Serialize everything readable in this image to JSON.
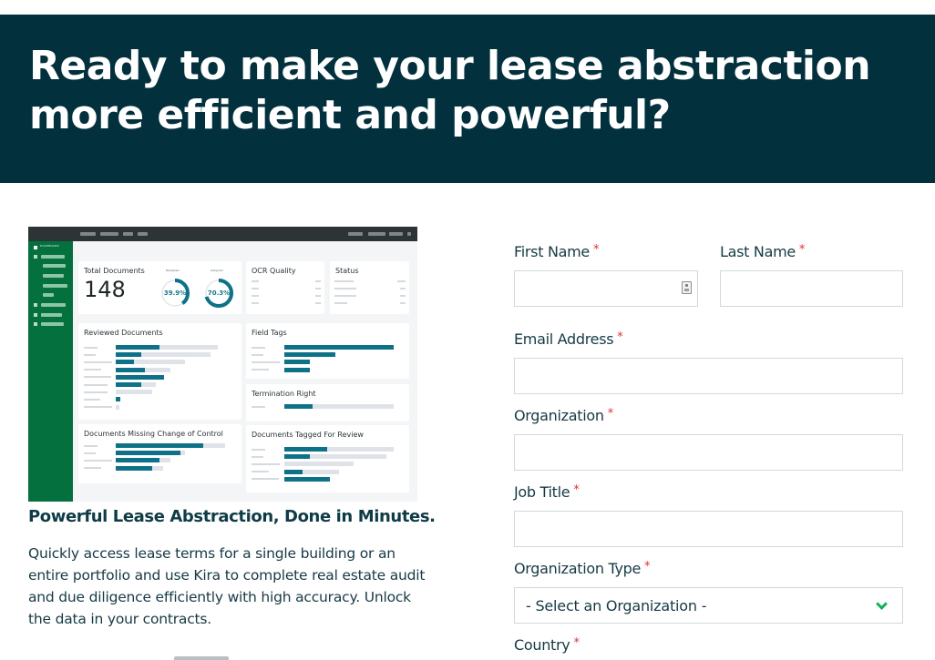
{
  "hero": {
    "title": "Ready to make your lease abstraction more efficient and powerful?",
    "background_color": "#02303d"
  },
  "dashboard_preview": {
    "sidebar_label": "DASHBOARD",
    "sidebar_color": "#04703e",
    "accent_color": "#0d7188",
    "total_documents": {
      "label": "Total Documents",
      "value": "148",
      "reviewed": {
        "label": "Reviewed",
        "value": "39.9%",
        "fraction": 0.399
      },
      "assigned": {
        "label": "Assigned",
        "value": "70.3%",
        "fraction": 0.703
      }
    },
    "ocr_quality": {
      "title": "OCR Quality"
    },
    "status": {
      "title": "Status"
    },
    "reviewed_documents": {
      "title": "Reviewed Documents",
      "bars": [
        {
          "total": 0.93,
          "filled": 0.4
        },
        {
          "total": 0.87,
          "filled": 0.23
        },
        {
          "total": 0.63,
          "filled": 0.17
        },
        {
          "total": 0.5,
          "filled": 0.27
        },
        {
          "total": 0.44,
          "filled": 0.44
        },
        {
          "total": 0.37,
          "filled": 0.23
        },
        {
          "total": 0.33,
          "filled": 0.0
        },
        {
          "total": 0.04,
          "filled": 0.04
        },
        {
          "total": 0.03,
          "filled": 0.0
        }
      ]
    },
    "field_tags": {
      "title": "Field Tags",
      "bars": [
        {
          "total": 1.0,
          "filled": 1.0
        },
        {
          "total": 0.47,
          "filled": 0.47
        },
        {
          "total": 0.23,
          "filled": 0.23
        },
        {
          "total": 0.23,
          "filled": 0.23
        }
      ]
    },
    "termination_right": {
      "title": "Termination Right",
      "bars": [
        {
          "total": 1.0,
          "filled": 0.26
        }
      ]
    },
    "missing_change_of_control": {
      "title": "Documents Missing Change of Control",
      "bars": [
        {
          "total": 1.0,
          "filled": 0.8
        },
        {
          "total": 0.63,
          "filled": 0.59
        },
        {
          "total": 0.5,
          "filled": 0.4
        },
        {
          "total": 0.43,
          "filled": 0.33
        }
      ]
    },
    "tagged_for_review": {
      "title": "Documents Tagged For Review",
      "bars": [
        {
          "total": 1.0,
          "filled": 0.39
        },
        {
          "total": 0.93,
          "filled": 0.23
        },
        {
          "total": 0.63,
          "filled": 0.0
        },
        {
          "total": 0.5,
          "filled": 0.17
        },
        {
          "total": 0.42,
          "filled": 0.42
        }
      ]
    }
  },
  "feature": {
    "heading": "Powerful Lease Abstraction, Done in Minutes.",
    "description": "Quickly access lease terms for a single building or an entire portfolio and use Kira to complete real estate audit and due diligence efficiently with high accuracy. Unlock the data in your contracts."
  },
  "form": {
    "required_marker": "*",
    "first_name": {
      "label": "First Name",
      "value": ""
    },
    "last_name": {
      "label": "Last Name",
      "value": ""
    },
    "email": {
      "label": "Email Address",
      "value": ""
    },
    "organization": {
      "label": "Organization",
      "value": ""
    },
    "job_title": {
      "label": "Job Title",
      "value": ""
    },
    "organization_type": {
      "label": "Organization Type",
      "selected": "- Select an Organization -"
    },
    "country": {
      "label": "Country"
    }
  }
}
